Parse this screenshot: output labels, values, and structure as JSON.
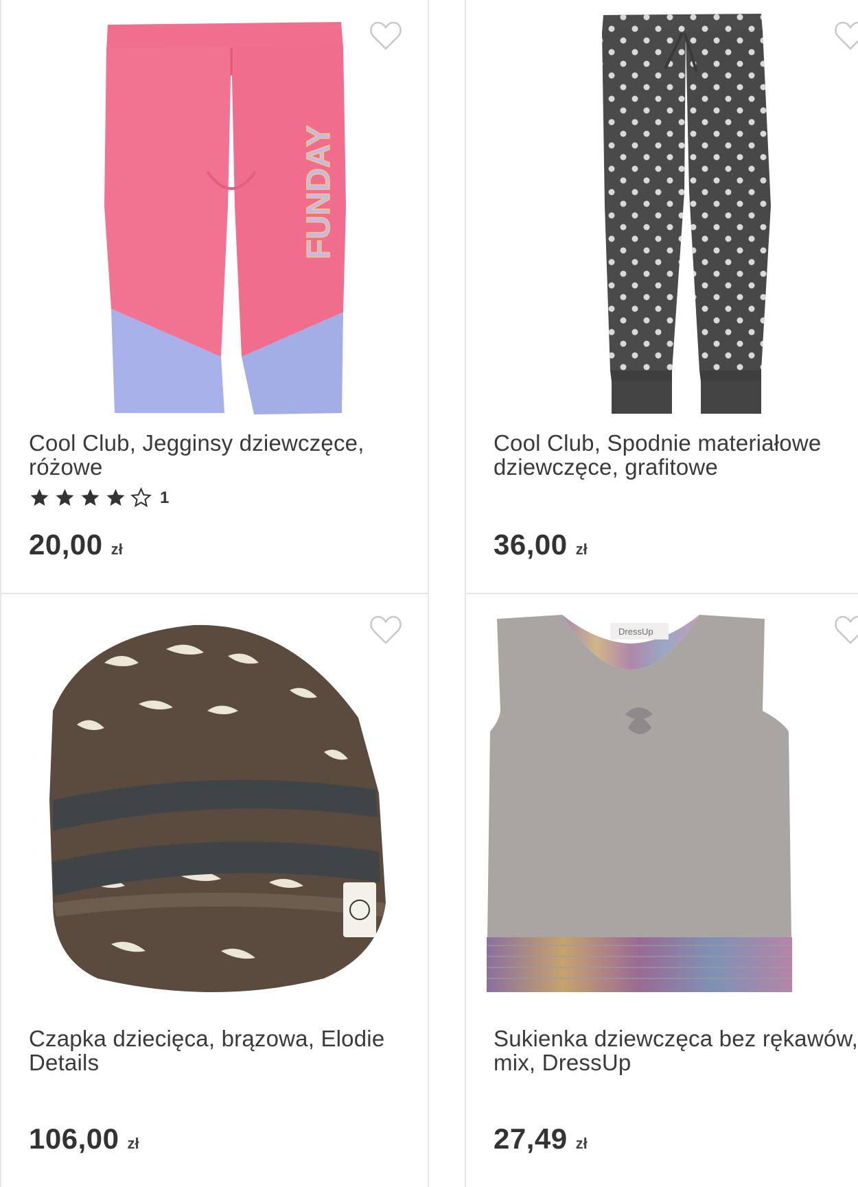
{
  "products": [
    {
      "title": "Cool Club, Jegginsy dziewczęce, różowe",
      "title_line1": "Cool Club, Jegginsy dziewczęce,",
      "title_line2": "różowe",
      "rating": 4,
      "rating_max": 5,
      "review_count": "1",
      "price": "20,00",
      "currency": "zł",
      "image_icon": "pink-leggings-image",
      "graphic_text": "FUNDAY"
    },
    {
      "title": "Cool Club, Spodnie materiałowe dziewczęce, grafitowe",
      "title_line1": "Cool Club, Spodnie materiałowe",
      "title_line2": "dziewczęce, grafitowe",
      "price": "36,00",
      "currency": "zł",
      "image_icon": "polka-dot-trousers-image"
    },
    {
      "title": "Czapka dziecięca, brązowa, Elodie Details",
      "title_line1": "Czapka dziecięca, brązowa, Elodie",
      "title_line2": "Details",
      "price": "106,00",
      "currency": "zł",
      "image_icon": "brown-beanie-image"
    },
    {
      "title": "Sukienka dziewczęca bez rękawów, mix, DressUp",
      "title_line1": "Sukienka dziewczęca bez rękawów,",
      "title_line2": "mix, DressUp",
      "price": "27,49",
      "currency": "zł",
      "image_icon": "grey-sleeveless-dress-image",
      "label_text": "DressUp"
    }
  ],
  "colors": {
    "text": "#3a3a3a",
    "border": "#e6e6e6",
    "star": "#333333",
    "heart_outline": "#c8c8c8"
  }
}
